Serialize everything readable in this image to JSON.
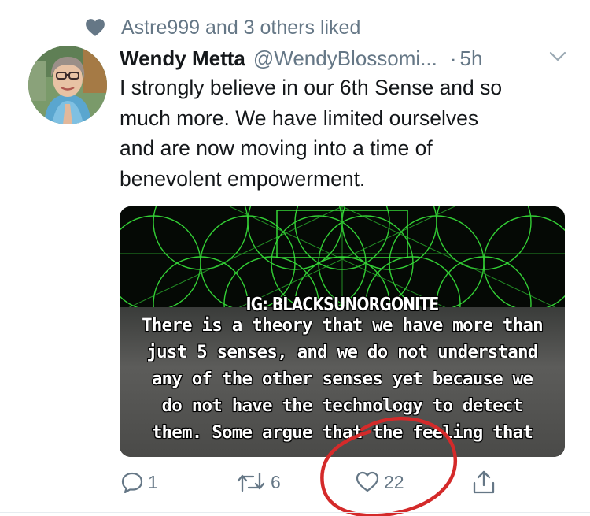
{
  "social_context": {
    "text": "Astre999 and 3 others liked",
    "icon": "heart-icon"
  },
  "tweet": {
    "author_name": "Wendy Metta",
    "author_handle": "@WendyBlossomi...",
    "separator": "·",
    "time": "5h",
    "text": "I strongly believe in our 6th Sense and so\nmuch more.  We have limited ourselves\nand are now moving into a time of\nbenevolent empowerment.",
    "media": {
      "tag": "IG: BLACKSUNORGONITE",
      "caption": "There is a theory that we have more than\njust 5 senses, and we do not understand\nany of the other senses yet because we\ndo not have the technology to detect\nthem. Some argue that the feeling that"
    },
    "actions": {
      "reply_count": "1",
      "retweet_count": "6",
      "like_count": "22"
    }
  },
  "colors": {
    "text_primary": "#14171a",
    "text_secondary": "#657786",
    "annotation_red": "#d42a2a",
    "media_green": "#39e63b"
  }
}
